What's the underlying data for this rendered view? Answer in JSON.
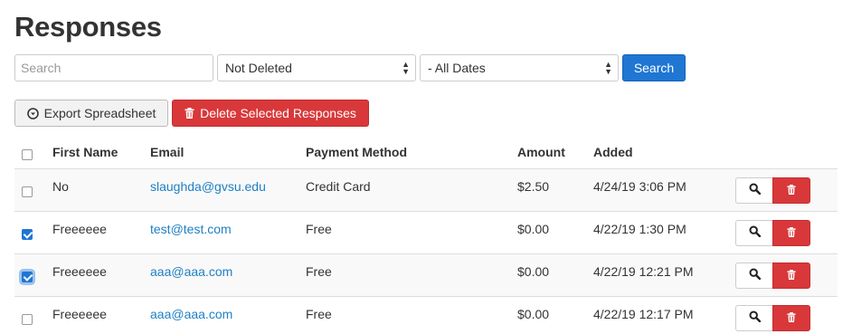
{
  "page": {
    "title": "Responses"
  },
  "filters": {
    "search_placeholder": "Search",
    "status_selected": "Not Deleted",
    "date_selected": "- All Dates",
    "search_button": "Search"
  },
  "actions": {
    "export_label": "Export Spreadsheet",
    "delete_selected_label": "Delete Selected Responses"
  },
  "table": {
    "columns": [
      "First Name",
      "Email",
      "Payment Method",
      "Amount",
      "Added"
    ],
    "rows": [
      {
        "first_name": "No",
        "email": "slaughda@gvsu.edu",
        "payment_method": "Credit Card",
        "amount": "$2.50",
        "added": "4/24/19 3:06 PM",
        "checked": false
      },
      {
        "first_name": "Freeeeee",
        "email": "test@test.com",
        "payment_method": "Free",
        "amount": "$0.00",
        "added": "4/22/19 1:30 PM",
        "checked": true
      },
      {
        "first_name": "Freeeeee",
        "email": "aaa@aaa.com",
        "payment_method": "Free",
        "amount": "$0.00",
        "added": "4/22/19 12:21 PM",
        "checked": true
      },
      {
        "first_name": "Freeeeee",
        "email": "aaa@aaa.com",
        "payment_method": "Free",
        "amount": "$0.00",
        "added": "4/22/19 12:17 PM",
        "checked": false
      }
    ]
  },
  "colors": {
    "primary": "#1f76d3",
    "danger": "#d9383a",
    "link": "#1f7fc3"
  },
  "icons": {
    "export": "circle-down-arrow-icon",
    "delete": "trash-icon",
    "view": "magnifier-icon"
  }
}
